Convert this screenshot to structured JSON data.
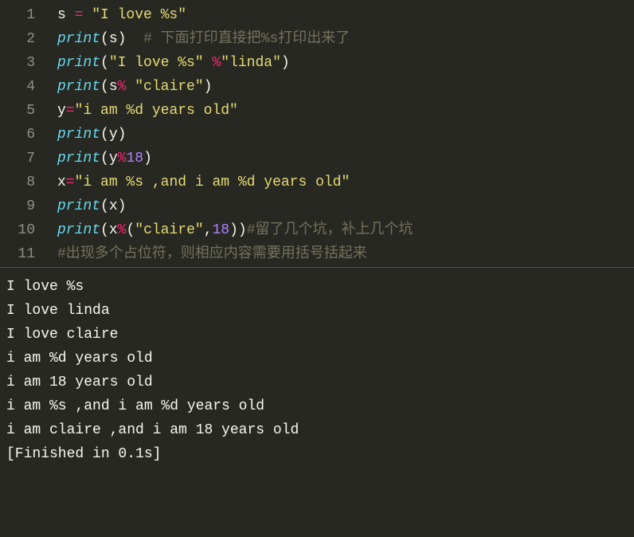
{
  "editor": {
    "lines": [
      {
        "num": "1",
        "tokens": [
          {
            "t": "s ",
            "c": "var"
          },
          {
            "t": "= ",
            "c": "op"
          },
          {
            "t": "\"I love %s\"",
            "c": "str"
          }
        ]
      },
      {
        "num": "2",
        "tokens": [
          {
            "t": "print",
            "c": "func"
          },
          {
            "t": "(",
            "c": "paren"
          },
          {
            "t": "s",
            "c": "var"
          },
          {
            "t": ")  ",
            "c": "paren"
          },
          {
            "t": "# 下面打印直接把%s打印出来了",
            "c": "cmt"
          }
        ]
      },
      {
        "num": "3",
        "tokens": [
          {
            "t": "print",
            "c": "func"
          },
          {
            "t": "(",
            "c": "paren"
          },
          {
            "t": "\"I love %s\" ",
            "c": "str"
          },
          {
            "t": "%",
            "c": "op"
          },
          {
            "t": "\"linda\"",
            "c": "str"
          },
          {
            "t": ")",
            "c": "paren"
          }
        ]
      },
      {
        "num": "4",
        "tokens": [
          {
            "t": "print",
            "c": "func"
          },
          {
            "t": "(",
            "c": "paren"
          },
          {
            "t": "s",
            "c": "var"
          },
          {
            "t": "% ",
            "c": "op"
          },
          {
            "t": "\"claire\"",
            "c": "str"
          },
          {
            "t": ")",
            "c": "paren"
          }
        ]
      },
      {
        "num": "5",
        "tokens": [
          {
            "t": "y",
            "c": "var"
          },
          {
            "t": "=",
            "c": "op"
          },
          {
            "t": "\"i am %d years old\"",
            "c": "str"
          }
        ]
      },
      {
        "num": "6",
        "tokens": [
          {
            "t": "print",
            "c": "func"
          },
          {
            "t": "(",
            "c": "paren"
          },
          {
            "t": "y",
            "c": "var"
          },
          {
            "t": ")",
            "c": "paren"
          }
        ]
      },
      {
        "num": "7",
        "tokens": [
          {
            "t": "print",
            "c": "func"
          },
          {
            "t": "(",
            "c": "paren"
          },
          {
            "t": "y",
            "c": "var"
          },
          {
            "t": "%",
            "c": "op"
          },
          {
            "t": "18",
            "c": "num"
          },
          {
            "t": ")",
            "c": "paren"
          }
        ]
      },
      {
        "num": "8",
        "tokens": [
          {
            "t": "x",
            "c": "var"
          },
          {
            "t": "=",
            "c": "op"
          },
          {
            "t": "\"i am %s ,and i am %d years old\"",
            "c": "str"
          }
        ]
      },
      {
        "num": "9",
        "tokens": [
          {
            "t": "print",
            "c": "func"
          },
          {
            "t": "(",
            "c": "paren"
          },
          {
            "t": "x",
            "c": "var"
          },
          {
            "t": ")",
            "c": "paren"
          }
        ]
      },
      {
        "num": "10",
        "tokens": [
          {
            "t": "print",
            "c": "func"
          },
          {
            "t": "(",
            "c": "paren"
          },
          {
            "t": "x",
            "c": "var"
          },
          {
            "t": "%",
            "c": "op"
          },
          {
            "t": "(",
            "c": "paren"
          },
          {
            "t": "\"claire\"",
            "c": "str"
          },
          {
            "t": ",",
            "c": "paren"
          },
          {
            "t": "18",
            "c": "num"
          },
          {
            "t": ")",
            "c": "paren"
          },
          {
            "t": ")",
            "c": "paren"
          },
          {
            "t": "#留了几个坑，补上几个坑",
            "c": "cmt"
          }
        ]
      },
      {
        "num": "11",
        "tokens": [
          {
            "t": "#出现多个占位符，则相应内容需要用括号括起来",
            "c": "cmt"
          }
        ]
      }
    ]
  },
  "output": {
    "lines": [
      "I love %s",
      "I love linda",
      "I love claire",
      "i am %d years old",
      "i am 18 years old",
      "i am %s ,and i am %d years old",
      "i am claire ,and i am 18 years old",
      "[Finished in 0.1s]"
    ]
  }
}
